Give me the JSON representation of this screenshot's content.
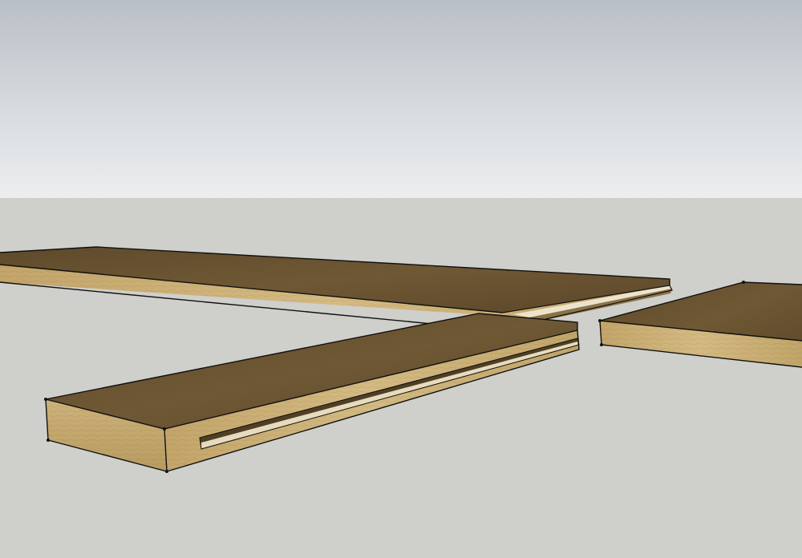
{
  "scene": {
    "type": "3d-model-viewport",
    "colors": {
      "sky_top": "#b9bfc6",
      "sky_bottom": "#eceeef",
      "ground": "#cfcfcb",
      "board_top": "#6b5532",
      "board_top_dark": "#5a4629",
      "board_edge": "#c9ad72",
      "board_edge_light": "#d8bf86",
      "board_edge_dark": "#b3965c",
      "outline": "#111111"
    },
    "objects": [
      {
        "name": "long-board",
        "kind": "wood-plank"
      },
      {
        "name": "front-board",
        "kind": "wood-plank-with-groove"
      },
      {
        "name": "right-board",
        "kind": "wood-plank"
      }
    ]
  }
}
